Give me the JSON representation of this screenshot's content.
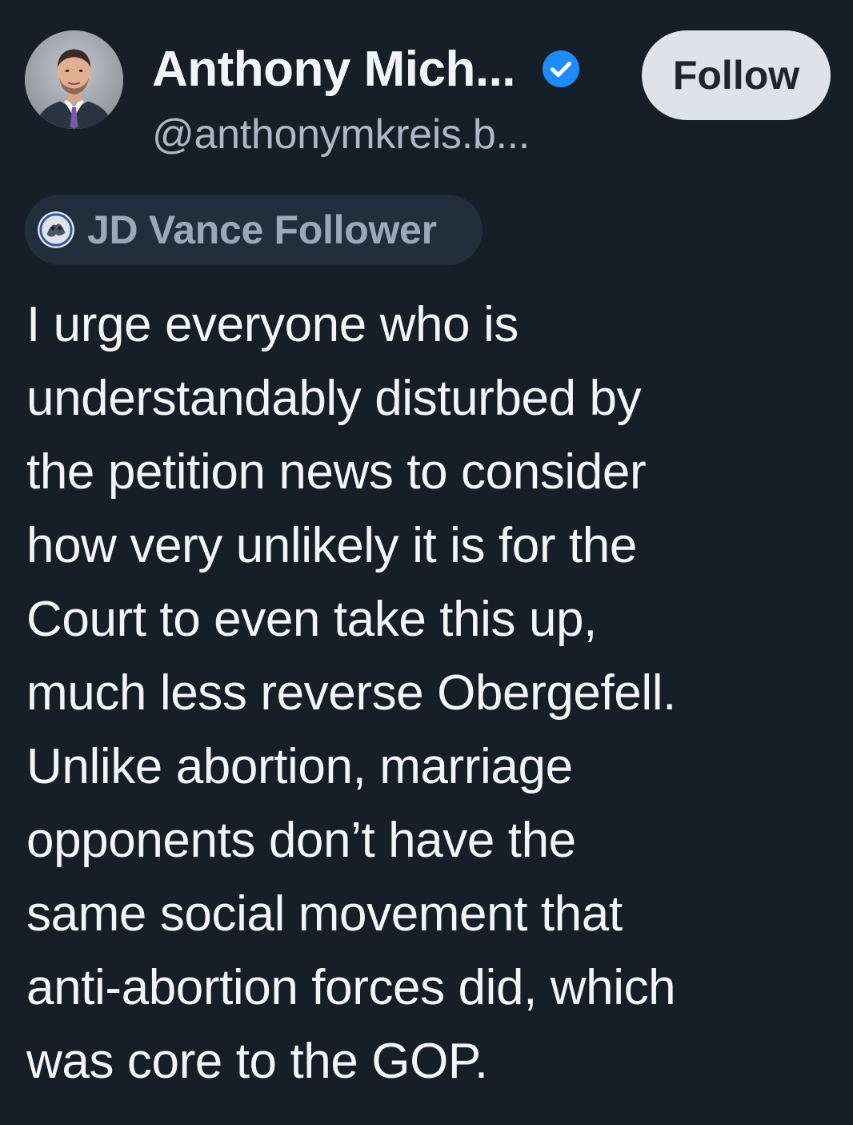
{
  "author": {
    "display_name": "Anthony Mich...",
    "handle": "@anthonymkreis.b...",
    "verified_color": "#1d8cf8"
  },
  "follow_button": {
    "label": "Follow"
  },
  "label_badge": {
    "text": "JD Vance Follower"
  },
  "post": {
    "lines": [
      "I urge everyone who is",
      "understandably disturbed by",
      "the petition news to consider",
      "how very unlikely it is for the",
      "Court to even take this up,",
      "much less reverse Obergefell.",
      "Unlike abortion, marriage",
      "opponents don’t have the",
      "same social movement that",
      "anti-abortion forces did, which",
      "was core to the GOP."
    ]
  },
  "colors": {
    "background": "#161e27",
    "text_primary": "#f2f5f8",
    "text_secondary": "#aeb8c4",
    "badge_bg": "#222e3b",
    "follow_bg": "#dde3e9"
  }
}
